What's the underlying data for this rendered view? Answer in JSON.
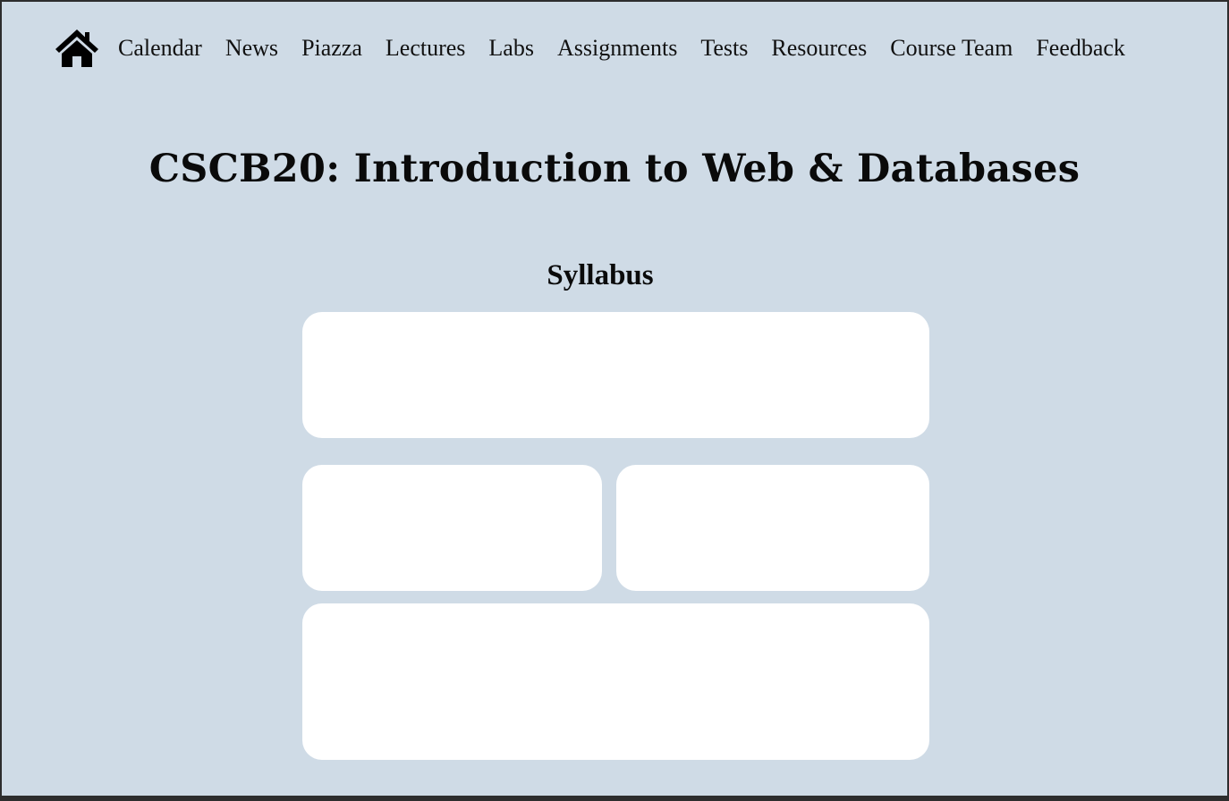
{
  "nav": {
    "home_icon": "home-icon",
    "links": [
      "Calendar",
      "News",
      "Piazza",
      "Lectures",
      "Labs",
      "Assignments",
      "Tests",
      "Resources",
      "Course Team",
      "Feedback"
    ]
  },
  "page": {
    "title": "CSCB20: Introduction to Web & Databases",
    "section_title": "Syllabus"
  },
  "colors": {
    "background": "#cfdbe6",
    "card": "#ffffff",
    "text": "#0a0a0a"
  }
}
